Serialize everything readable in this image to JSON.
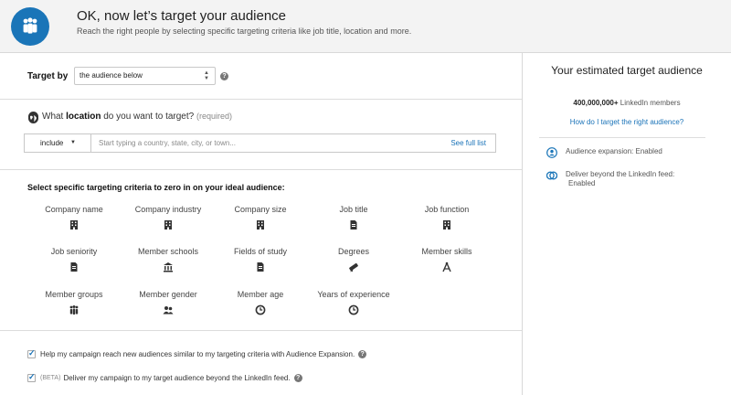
{
  "header": {
    "title": "OK, now let’s target your audience",
    "subtitle": "Reach the right people by selecting specific targeting criteria like job title, location and more."
  },
  "target": {
    "label": "Target by",
    "selected": "the audience below",
    "help": "?"
  },
  "location": {
    "prefix": "What ",
    "keyword": "location",
    "suffix": " do you want to target?",
    "required": "(required)",
    "include_label": "include",
    "placeholder": "Start typing a country, state, city, or town...",
    "see_full_list": "See full list"
  },
  "criteria": {
    "title": "Select specific targeting criteria to zero in on your ideal audience:",
    "items": [
      {
        "label": "Company name",
        "icon": "building-icon"
      },
      {
        "label": "Company industry",
        "icon": "building-icon"
      },
      {
        "label": "Company size",
        "icon": "building-icon"
      },
      {
        "label": "Job title",
        "icon": "document-icon"
      },
      {
        "label": "Job function",
        "icon": "building-icon"
      },
      {
        "label": "Job seniority",
        "icon": "document-icon"
      },
      {
        "label": "Member schools",
        "icon": "school-icon"
      },
      {
        "label": "Fields of study",
        "icon": "document-icon"
      },
      {
        "label": "Degrees",
        "icon": "diploma-icon"
      },
      {
        "label": "Member skills",
        "icon": "compass-icon"
      },
      {
        "label": "Member groups",
        "icon": "group-icon"
      },
      {
        "label": "Member gender",
        "icon": "gender-icon"
      },
      {
        "label": "Member age",
        "icon": "clock-icon"
      },
      {
        "label": "Years of experience",
        "icon": "clock-icon"
      }
    ]
  },
  "checks": {
    "expansion": "Help my campaign reach new audiences similar to my targeting criteria with Audience Expansion.",
    "beta_tag": "(BETA)",
    "beyond_feed": "Deliver my campaign to my target audience beyond the LinkedIn feed."
  },
  "estimate": {
    "title": "Your estimated target audience",
    "count": "400,000,000+",
    "count_suffix": " LinkedIn members",
    "link": "How do I target the right audience?",
    "expansion_status": "Audience expansion:  Enabled",
    "beyond_line1": "Deliver beyond the LinkedIn feed:",
    "beyond_line2": "Enabled"
  },
  "colors": {
    "brand_blue": "#1a75b8",
    "link_blue": "#1a73b8"
  }
}
